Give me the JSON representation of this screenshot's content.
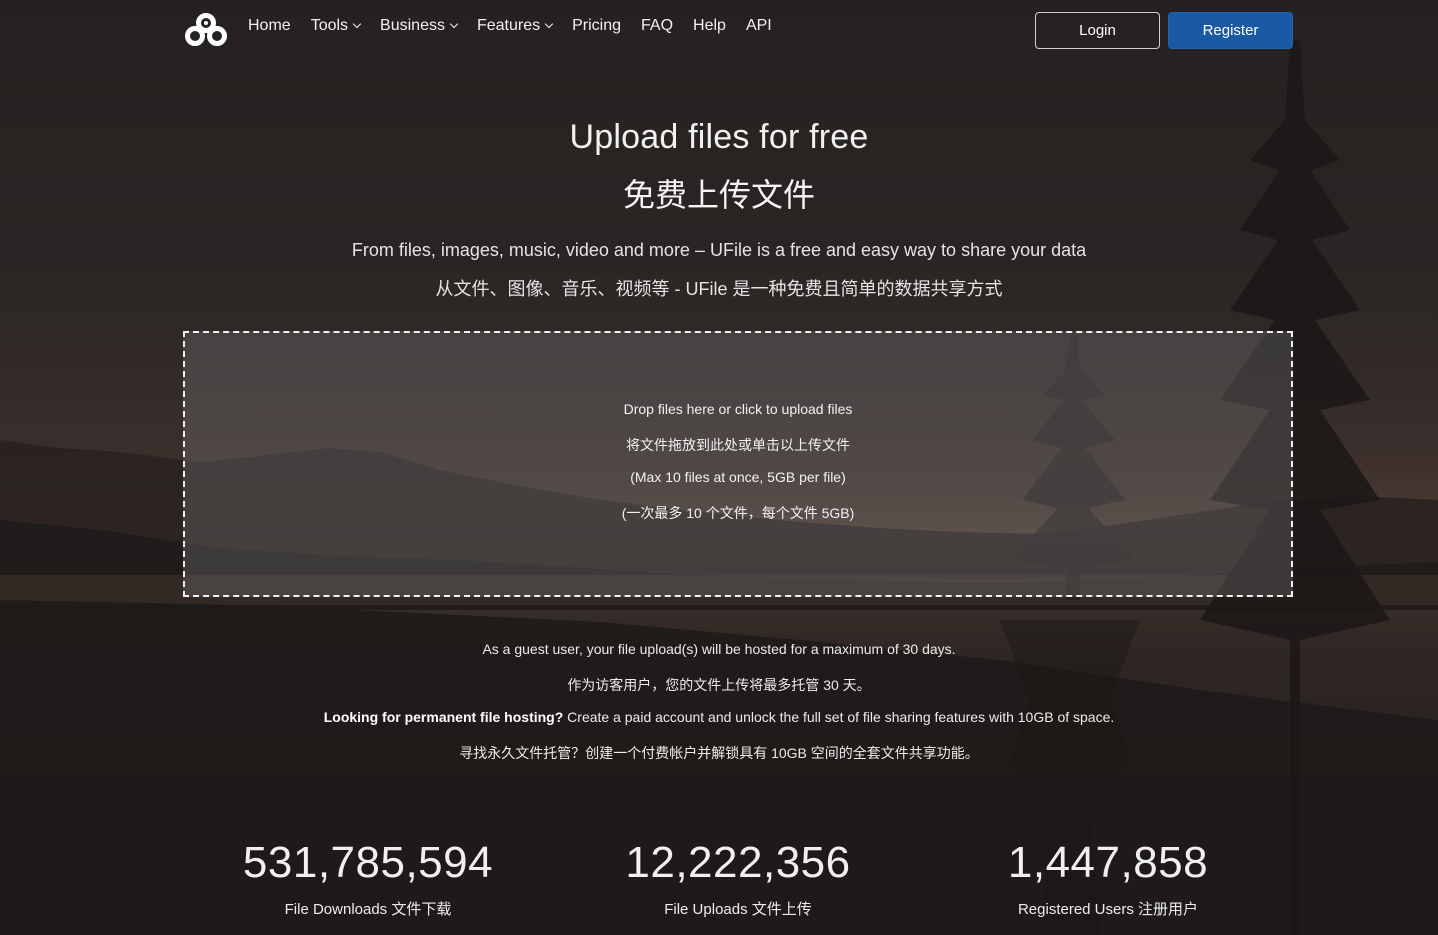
{
  "nav": {
    "home": "Home",
    "tools": "Tools",
    "business": "Business",
    "features": "Features",
    "pricing": "Pricing",
    "faq": "FAQ",
    "help": "Help",
    "api": "API",
    "login": "Login",
    "register": "Register"
  },
  "hero": {
    "title": "Upload files for free",
    "title_cn": "免费上传文件",
    "subtitle": "From files, images, music, video and more – UFile is a free and easy way to share your data",
    "subtitle_cn": "从文件、图像、音乐、视频等 - UFile 是一种免费且简单的数据共享方式"
  },
  "dropzone": {
    "line1": "Drop files here or click to upload files",
    "line2": "将文件拖放到此处或单击以上传文件",
    "line3": "(Max 10 files at once, 5GB per file)",
    "line4": "(一次最多 10 个文件，每个文件 5GB)"
  },
  "info": {
    "guest": "As a guest user, your file upload(s) will be hosted for a maximum of 30 days.",
    "guest_cn": "作为访客用户，您的文件上传将最多托管 30 天。",
    "permanent_bold": "Looking for permanent file hosting?",
    "permanent_rest": " Create a paid account and unlock the full set of file sharing features with 10GB of space.",
    "permanent_cn": "寻找永久文件托管？创建一个付费帐户并解锁具有 10GB 空间的全套文件共享功能。"
  },
  "stats": [
    {
      "value": "531,785,594",
      "label": "File Downloads 文件下载"
    },
    {
      "value": "12,222,356",
      "label": "File Uploads 文件上传"
    },
    {
      "value": "1,447,858",
      "label": "Registered Users 注册用户"
    }
  ],
  "colors": {
    "register_button": "#1a5aa5"
  }
}
